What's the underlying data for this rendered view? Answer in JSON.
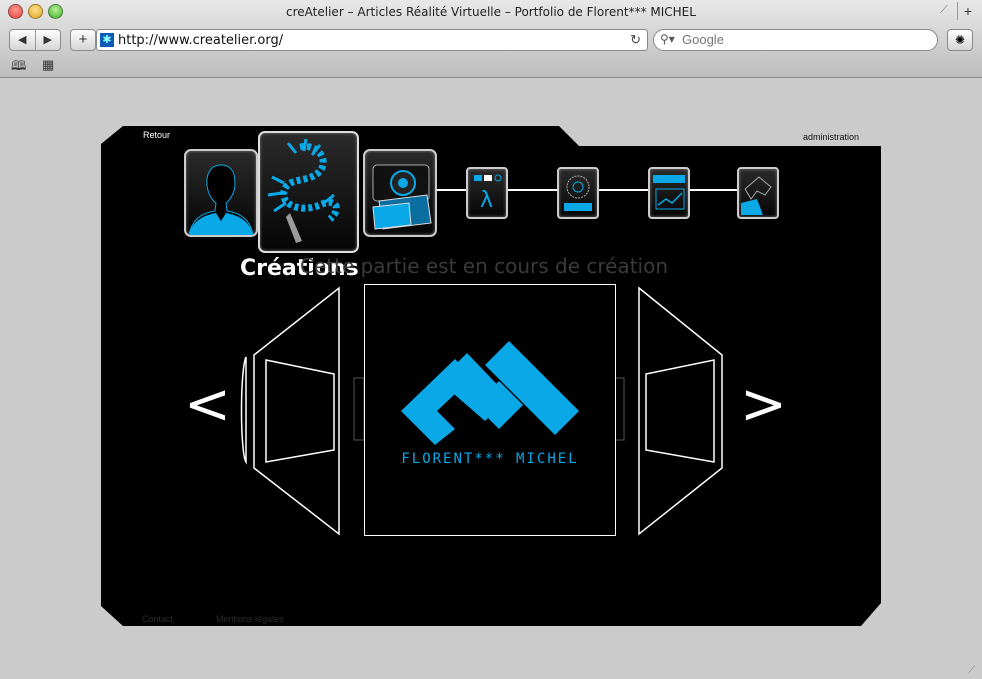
{
  "window": {
    "title": "creAtelier – Articles Réalité Virtuelle – Portfolio de Florent*** MICHEL"
  },
  "toolbar": {
    "back_icon": "◀",
    "forward_icon": "▶",
    "add_icon": "+",
    "url": "http://www.createlier.org/",
    "reload_icon": "↻",
    "search_placeholder": "Google",
    "search_icon": "search-icon",
    "bug_icon": "✺"
  },
  "bookmarks": {
    "book_icon": "📖",
    "grid_icon": "▦"
  },
  "site": {
    "retour": "Retour",
    "administration": "administration",
    "section_heading": "Créations",
    "notice": "Cette partie est en cours de création",
    "prev_arrow": "<",
    "next_arrow": ">",
    "logo_text": "FLORENT*** MICHEL",
    "footer": {
      "contact": "Contact",
      "legal": "Mentions légales"
    },
    "accent_color": "#0aa8e6",
    "menu_icons": [
      "profile-icon",
      "creations-icon",
      "camera-icon",
      "lambda-icon",
      "dial-icon",
      "media-player-icon",
      "hand-icon"
    ]
  }
}
